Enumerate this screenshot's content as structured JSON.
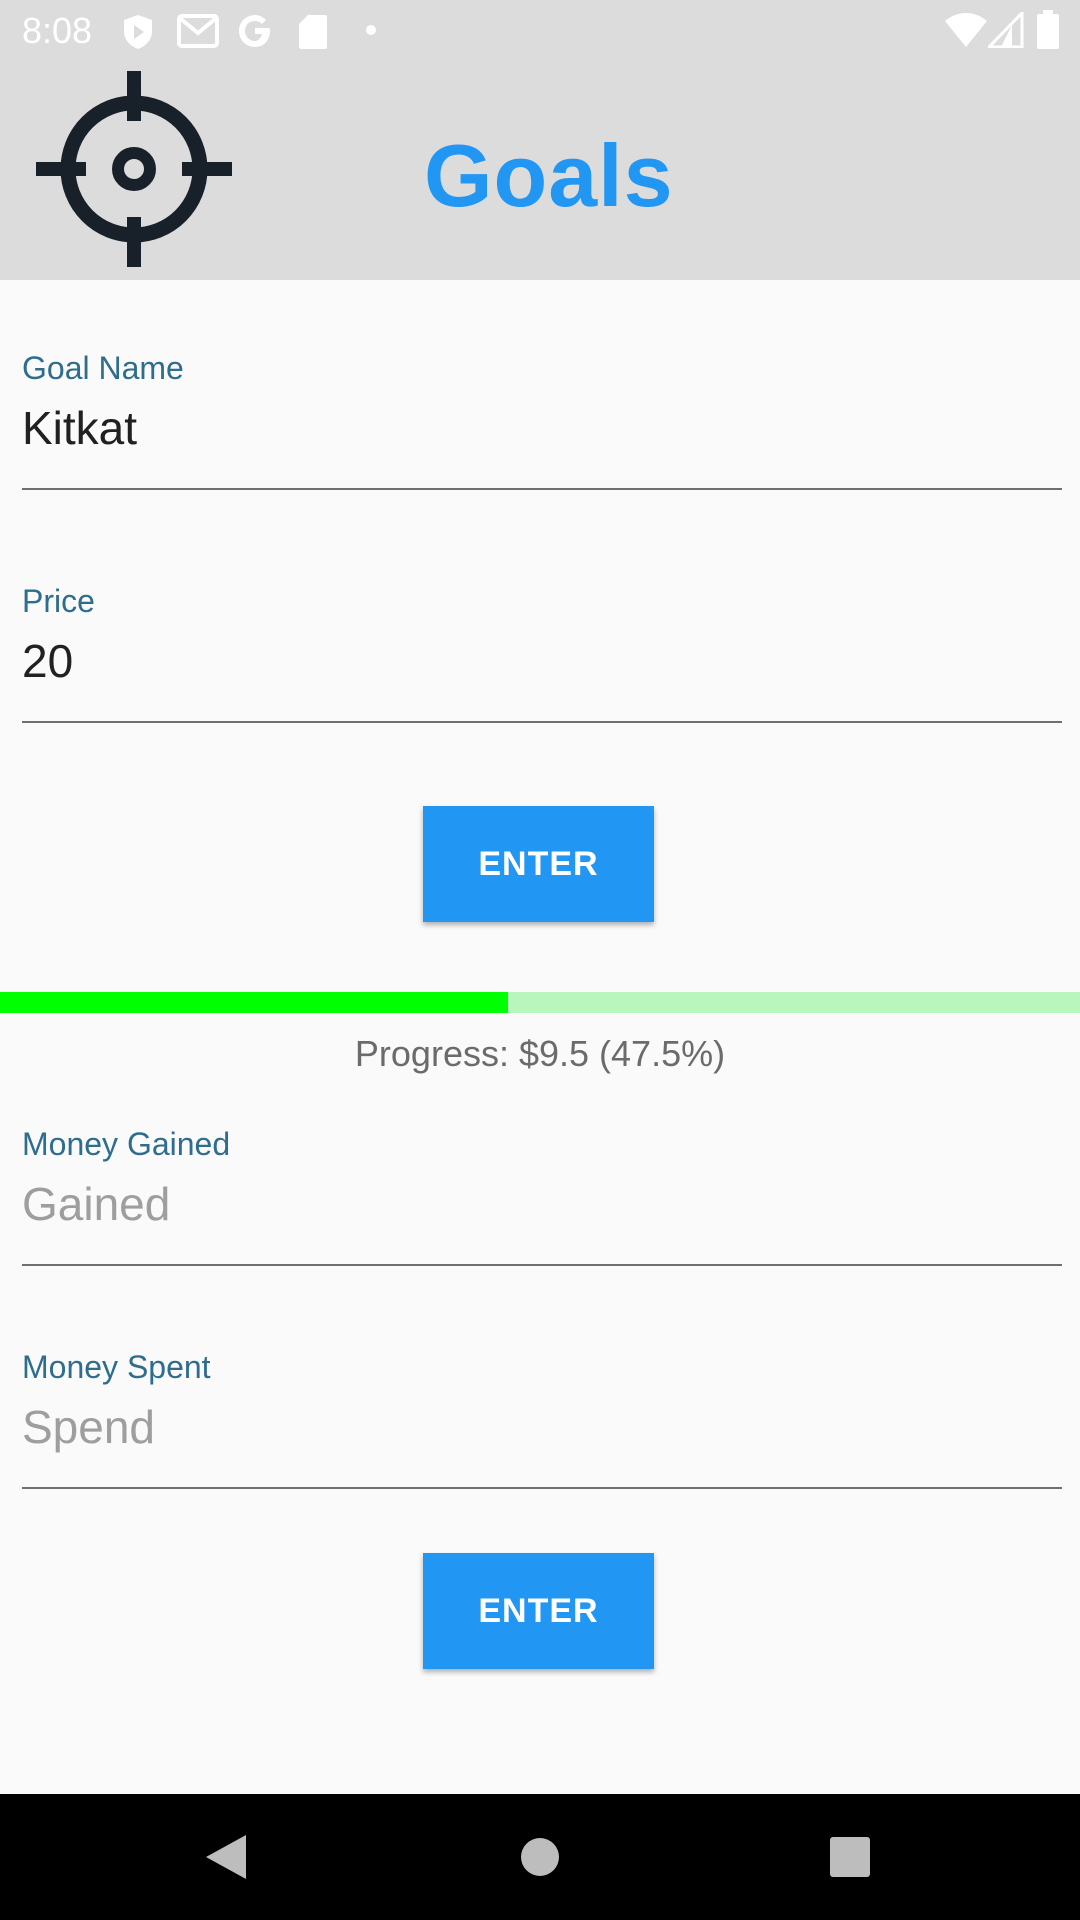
{
  "status_bar": {
    "time": "8:08",
    "left_icons": [
      "shield-notification-icon",
      "gmail-icon",
      "google-icon",
      "sd-card-icon",
      "dot-icon"
    ],
    "right_icons": [
      "wifi-icon",
      "cell-signal-icon",
      "battery-icon"
    ]
  },
  "header": {
    "icon": "target-crosshair-icon",
    "title": "Goals",
    "title_color": "#2196f3",
    "background": "#dcdcdc"
  },
  "goal_form": {
    "goal_name": {
      "label": "Goal Name",
      "value": "Kitkat"
    },
    "price": {
      "label": "Price",
      "value": "20"
    },
    "enter_label": "ENTER"
  },
  "progress": {
    "text": "Progress: $9.5 (47.5%)",
    "fraction": 0.47,
    "fill_color": "#00ff00",
    "track_color": "#b9f6be"
  },
  "money_form": {
    "gained": {
      "label": "Money Gained",
      "placeholder": "Gained",
      "value": ""
    },
    "spent": {
      "label": "Money Spent",
      "placeholder": "Spend",
      "value": ""
    },
    "enter_label": "ENTER"
  },
  "nav_bar": {
    "buttons": [
      "back-triangle-icon",
      "home-circle-icon",
      "recents-square-icon"
    ]
  },
  "accent_color": "#2196f3"
}
